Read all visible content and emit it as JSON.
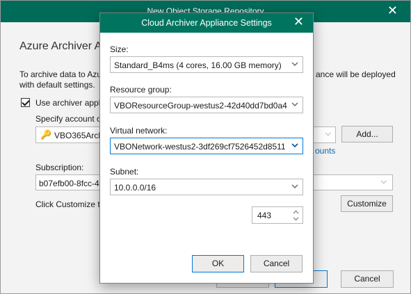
{
  "background_window": {
    "title": "New Object Storage Repository",
    "heading": "Azure Archiver A",
    "description_left": "To archive data to Azu with default settings.",
    "description_right": "ance will be deployed",
    "checkbox_label": "Use archiver appli",
    "specify_label": "Specify account o",
    "account_value": "VBO365Arch",
    "add_button": "Add...",
    "accounts_link": "ounts",
    "subscription_label": "Subscription:",
    "subscription_value": "b07efb00-8fcc-4",
    "customize_text": "Click Customize t",
    "customize_button": "Customize",
    "cancel_button": "Cancel"
  },
  "dialog": {
    "title": "Cloud Archiver Appliance Settings",
    "size": {
      "label": "Size:",
      "value": "Standard_B4ms (4 cores, 16.00 GB memory)"
    },
    "resource_group": {
      "label": "Resource group:",
      "value": "VBOResourceGroup-westus2-42d40dd7bd0a4"
    },
    "virtual_network": {
      "label": "Virtual network:",
      "value": "VBONetwork-westus2-3df269cf7526452d8511"
    },
    "subnet": {
      "label": "Subnet:",
      "value": "10.0.0.0/16"
    },
    "port": {
      "value": "443"
    },
    "ok_button": "OK",
    "cancel_button": "Cancel"
  },
  "colors": {
    "titlebar": "#00745f",
    "focus_border": "#0078d4",
    "link": "#0a6ab0"
  }
}
